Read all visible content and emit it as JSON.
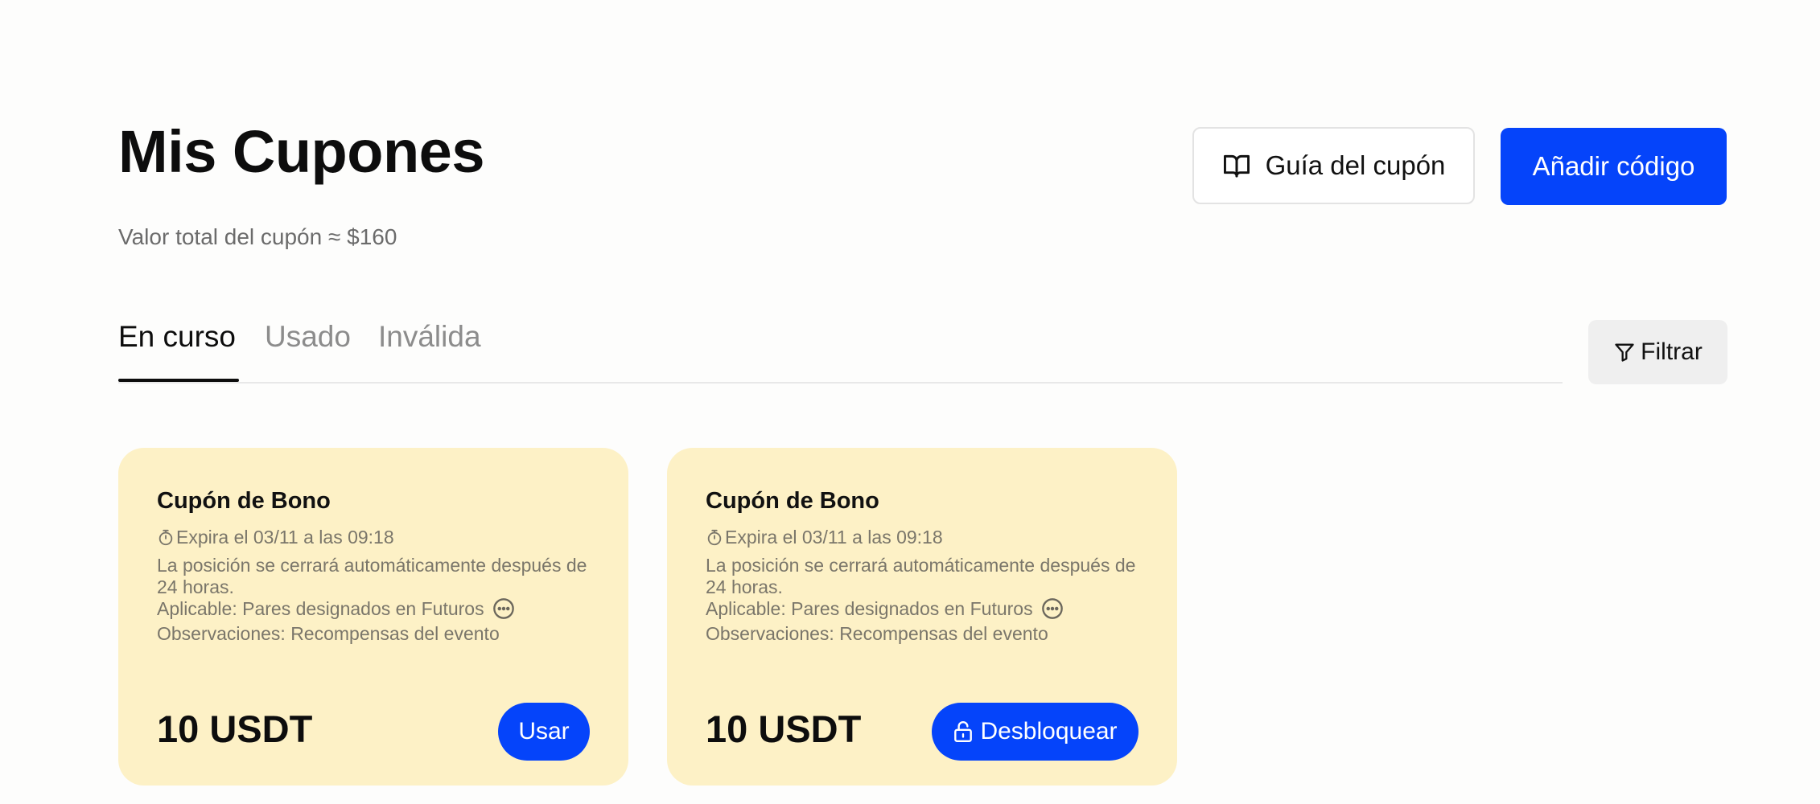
{
  "header": {
    "title": "Mis Cupones",
    "subtitle": "Valor total del cupón ≈ $160",
    "guide_button": "Guía del cupón",
    "add_button": "Añadir código"
  },
  "tabs": [
    {
      "label": "En curso",
      "active": true
    },
    {
      "label": "Usado",
      "active": false
    },
    {
      "label": "Inválida",
      "active": false
    }
  ],
  "filter_button": "Filtrar",
  "cards": [
    {
      "title": "Cupón de Bono",
      "expires": "Expira el 03/11 a las 09:18",
      "description": "La posición se cerrará automáticamente después de 24 horas.",
      "applicable": "Aplicable: Pares designados en Futuros",
      "notes": "Observaciones: Recompensas del evento",
      "amount": "10 USDT",
      "action": "Usar"
    },
    {
      "title": "Cupón de Bono",
      "expires": "Expira el 03/11 a las 09:18",
      "description": "La posición se cerrará automáticamente después de 24 horas.",
      "applicable": "Aplicable: Pares designados en Futuros",
      "notes": "Observaciones: Recompensas del evento",
      "amount": "10 USDT",
      "action": "Desbloquear"
    }
  ],
  "colors": {
    "accent": "#0544fa",
    "card_bg": "#fdf1c6",
    "muted_text": "#7a766a"
  },
  "icons": {
    "guide": "book-open-icon",
    "filter": "filter-funnel-icon",
    "expiry": "stopwatch-icon",
    "more": "more-dots-icon",
    "unlock": "unlock-icon"
  }
}
